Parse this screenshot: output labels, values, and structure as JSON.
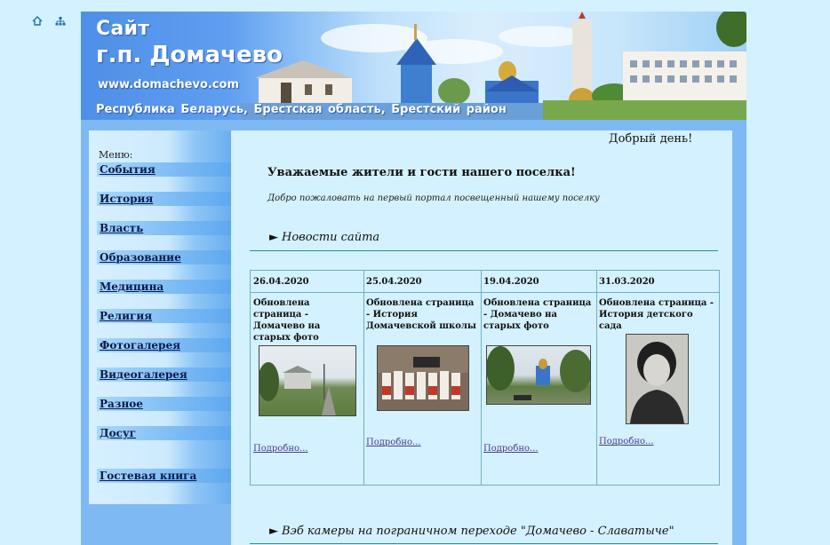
{
  "top_icons": [
    "home-icon",
    "sitemap-icon"
  ],
  "header": {
    "line1": "Сайт",
    "line2": "г.п. Домачево",
    "url": "www.domachevo.com",
    "region": "Республика Беларусь,  Брестская область,  Брестский район"
  },
  "sidebar": {
    "caption": "Меню:",
    "items": [
      {
        "label": "События"
      },
      {
        "label": "История"
      },
      {
        "label": "Власть"
      },
      {
        "label": "Образование"
      },
      {
        "label": "Медицина"
      },
      {
        "label": "Религия"
      },
      {
        "label": "Фотогалерея"
      },
      {
        "label": "Видеогалерея"
      },
      {
        "label": "Разное"
      },
      {
        "label": "Досуг"
      },
      {
        "label": "Гостевая книга"
      }
    ]
  },
  "main": {
    "greeting": "Добрый день!",
    "welcome_title": "Уважаемые жители и гости нашего поселка!",
    "welcome_text": "Добро пожаловать на первый портал посвещенный нашему поселку",
    "news_heading": "Новости сайта",
    "webcam_heading": "Вэб камеры на пограничном переходе \"Домачево - Славатыче\"",
    "arrow": "►",
    "news": [
      {
        "date": "26.04.2020",
        "title": "Обновлена страница - Домачево на старых фото",
        "more": "Подробно..."
      },
      {
        "date": "25.04.2020",
        "title": "Обновлена страница - История Домачевской школы",
        "more": "Подробно..."
      },
      {
        "date": "19.04.2020",
        "title": "Обновлена страница - Домачево на старых фото",
        "more": "Подробно..."
      },
      {
        "date": "31.03.2020",
        "title": "Обновлена страница - История детского сада",
        "more": "Подробно..."
      }
    ]
  }
}
